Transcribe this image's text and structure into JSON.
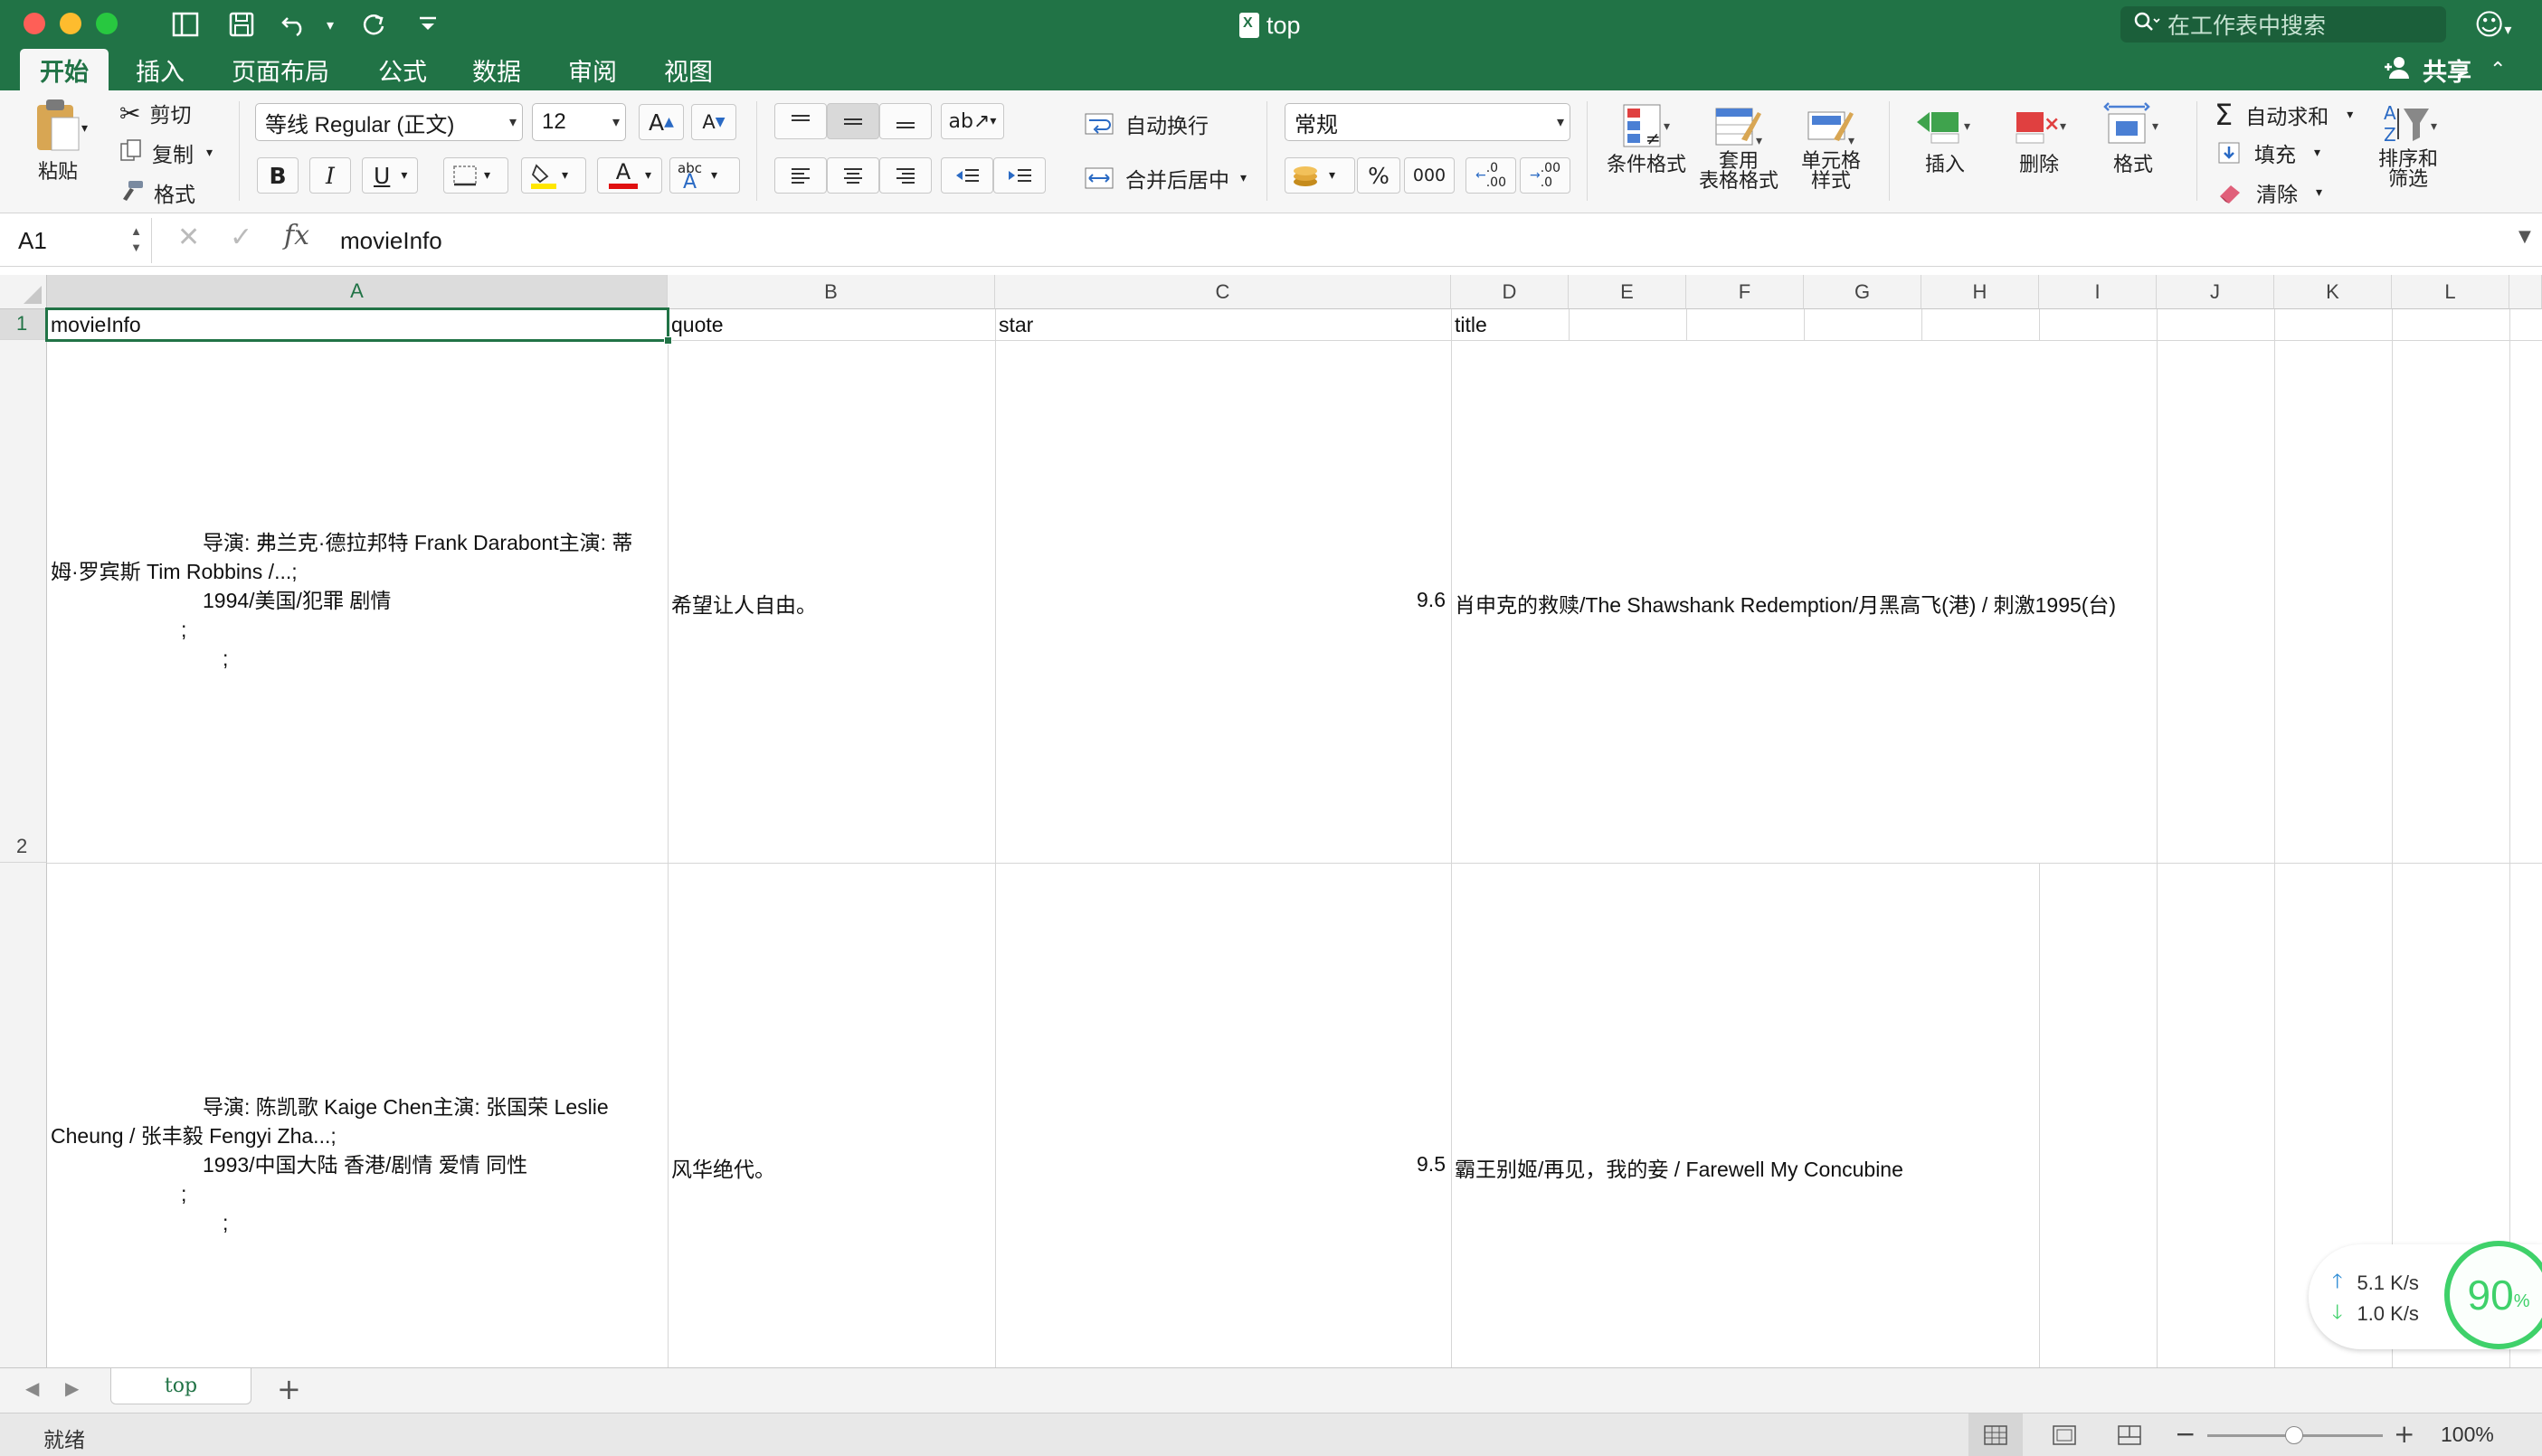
{
  "titlebar": {
    "title": "top",
    "search_placeholder": "在工作表中搜索"
  },
  "tabs": [
    "开始",
    "插入",
    "页面布局",
    "公式",
    "数据",
    "审阅",
    "视图"
  ],
  "share_label": "共享",
  "ribbon": {
    "paste": "粘贴",
    "cut": "剪切",
    "copy": "复制",
    "format_painter": "格式",
    "font_name": "等线 Regular (正文)",
    "font_size": "12",
    "bold": "B",
    "italic": "I",
    "underline": "U",
    "wrap_text": "自动换行",
    "merge_center": "合并后居中",
    "number_format": "常规",
    "percent": "%",
    "thousands": "000",
    "conditional_format": "条件格式",
    "table_format_1": "套用",
    "table_format_2": "表格格式",
    "cell_style_1": "单元格",
    "cell_style_2": "样式",
    "insert": "插入",
    "delete": "删除",
    "format": "格式",
    "autosum": "自动求和",
    "fill": "填充",
    "clear": "清除",
    "sort_1": "排序和",
    "sort_2": "筛选"
  },
  "formula_bar": {
    "cell_ref": "A1",
    "value": "movieInfo"
  },
  "columns": [
    "A",
    "B",
    "C",
    "D",
    "E",
    "F",
    "G",
    "H",
    "I",
    "J",
    "K",
    "L"
  ],
  "rows": [
    "1",
    "2"
  ],
  "headers": {
    "a": "movieInfo",
    "b": "quote",
    "c": "star",
    "d": "title"
  },
  "records": [
    {
      "info_1": "导演: 弗兰克·德拉邦特 Frank Darabont主演: 蒂",
      "info_2": "姆·罗宾斯 Tim Robbins /...;",
      "info_3": "1994/美国/犯罪 剧情",
      "info_4": ";",
      "info_5": ";",
      "quote": "希望让人自由。",
      "star": "9.6",
      "title": "肖申克的救赎/The Shawshank Redemption/月黑高飞(港)  /  刺激1995(台)"
    },
    {
      "info_1": "导演: 陈凯歌 Kaige Chen主演: 张国荣 Leslie",
      "info_2": "Cheung / 张丰毅 Fengyi Zha...;",
      "info_3": "1993/中国大陆 香港/剧情 爱情 同性",
      "info_4": ";",
      "info_5": ";",
      "quote": "风华绝代。",
      "star": "9.5",
      "title": "霸王别姬/再见，我的妾  /  Farewell My Concubine"
    }
  ],
  "speed_widget": {
    "upload": "5.1 K/s",
    "download": "1.0 K/s",
    "percent": "90",
    "percent_sign": "%"
  },
  "sheet_tab": "top",
  "status": {
    "ready": "就绪",
    "zoom": "100%"
  },
  "colors": {
    "accent": "#217346",
    "gauge": "#3fd16a"
  }
}
